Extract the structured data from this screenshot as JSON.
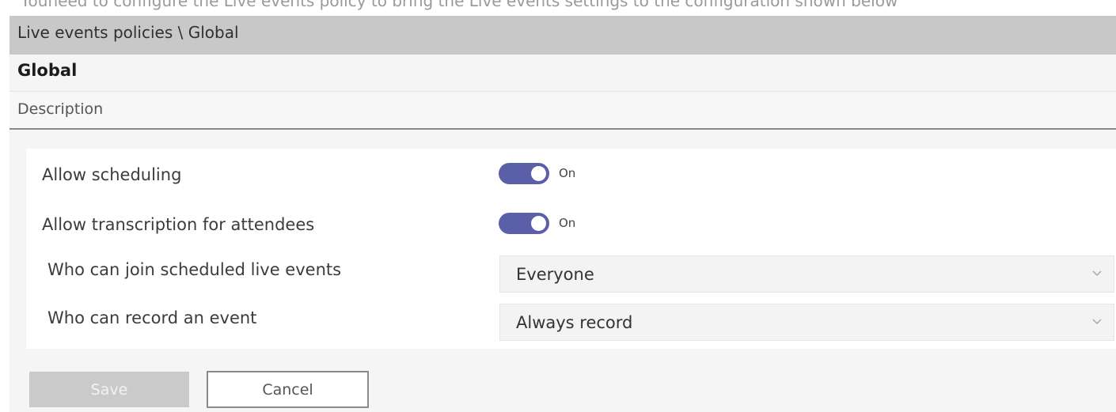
{
  "top_caption": "Youneed to configure the Live events policy to bring the Live events settings to the configuration shown below",
  "breadcrumb": "Live events policies \\ Global",
  "policy": {
    "name": "Global",
    "description_label": "Description"
  },
  "settings": {
    "allow_scheduling": {
      "label": "Allow scheduling",
      "state": "On"
    },
    "allow_transcription": {
      "label": "Allow transcription for attendees",
      "state": "On"
    },
    "who_can_join": {
      "label": "Who can join scheduled live events",
      "value": "Everyone"
    },
    "who_can_record": {
      "label": "Who can record an event",
      "value": "Always record"
    }
  },
  "buttons": {
    "save": "Save",
    "cancel": "Cancel"
  },
  "colors": {
    "toggle_on": "#5b5fa8",
    "breadcrumb_bar": "#c8c8c8",
    "panel_background": "#f5f5f5"
  },
  "icons": {
    "dropdown": "chevron-down-icon"
  }
}
